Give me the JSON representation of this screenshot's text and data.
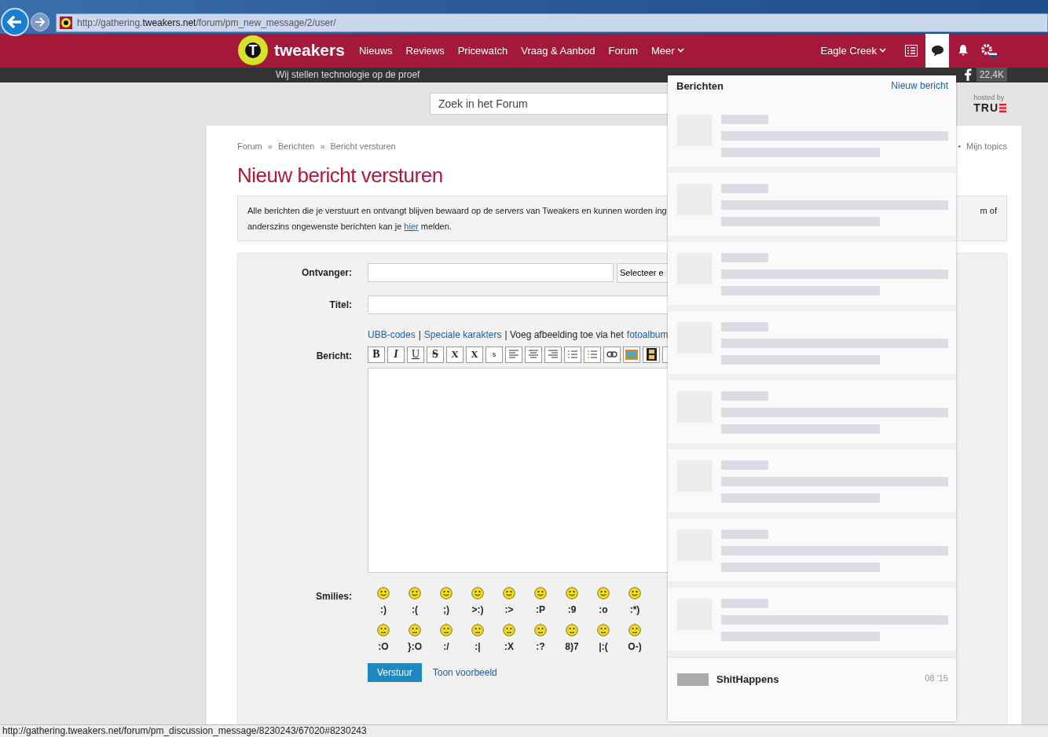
{
  "browser": {
    "url_before": "http://gathering.",
    "url_domain": "tweakers.net",
    "url_after": "/forum/pm_new_message/2/user/"
  },
  "nav": {
    "logo_mark": "T",
    "logo_text": "tweakers",
    "items": [
      {
        "label": "Nieuws",
        "caret": false
      },
      {
        "label": "Reviews",
        "caret": false
      },
      {
        "label": "Pricewatch",
        "caret": false
      },
      {
        "label": "Vraag & Aanbod",
        "caret": false
      },
      {
        "label": "Forum",
        "caret": false
      },
      {
        "label": "Meer",
        "caret": true
      }
    ],
    "user": "Eagle Creek",
    "icons": [
      {
        "kind": "list",
        "selected": false
      },
      {
        "kind": "chat",
        "selected": true
      },
      {
        "kind": "bell",
        "selected": false
      },
      {
        "kind": "settings",
        "selected": false
      }
    ]
  },
  "subbar": {
    "tagline": "Wij stellen technologie op de proef",
    "likes": "22,4K"
  },
  "search": {
    "placeholder": "Zoek in het Forum"
  },
  "hosting": {
    "label": "hosted by",
    "logo": "TRU"
  },
  "breadcrumb": {
    "separator": "»",
    "items": [
      "Forum",
      "Berichten",
      "Bericht versturen"
    ],
    "right_separator": "•",
    "right_link": "Mijn topics"
  },
  "title": "Nieuw bericht versturen",
  "notice": {
    "line_1": "Alle berichten die je verstuurt en ontvangt blijven bewaard op de servers van Tweakers en kunnen worden ing",
    "line_1_end": "m of",
    "line_2_before": "anderszins ongewenste berichten kan je",
    "link": "hier",
    "line_2_after": "melden."
  },
  "form": {
    "recipient_label": "Ontvanger:",
    "select_button": "Selecteer e",
    "title_label": "Titel:",
    "links": [
      {
        "label": "UBB-codes",
        "kind": "link"
      },
      {
        "label": "|",
        "kind": "text"
      },
      {
        "label": "Speciale karakters",
        "kind": "link"
      },
      {
        "label": "| Voeg afbeelding toe via het",
        "kind": "text"
      },
      {
        "label": "fotoalbum",
        "kind": "link"
      }
    ],
    "message_label": "Bericht:",
    "smilies_label": "Smilies:",
    "submit": "Verstuur",
    "preview": "Toon voorbeeld"
  },
  "toolbar": [
    {
      "kind": "text",
      "label": "B"
    },
    {
      "kind": "text",
      "label": "I"
    },
    {
      "kind": "text",
      "label": "U"
    },
    {
      "kind": "text",
      "label": "S"
    },
    {
      "kind": "text",
      "label": "X"
    },
    {
      "kind": "text",
      "label": "X"
    },
    {
      "kind": "text",
      "label": "s"
    },
    {
      "kind": "align_left"
    },
    {
      "kind": "align_center"
    },
    {
      "kind": "align_right"
    },
    {
      "kind": "bullets"
    },
    {
      "kind": "numbers"
    },
    {
      "kind": "link"
    },
    {
      "kind": "image"
    },
    {
      "kind": "video"
    },
    {
      "kind": "partial"
    }
  ],
  "smilies": [
    [
      ":)",
      ":(",
      ";)",
      ">:)",
      ":>",
      ":P",
      ":9",
      ":o",
      ":*)"
    ],
    [
      ":O",
      "}:O",
      ":/",
      ":|",
      ":X",
      ":?",
      "8)7",
      "|:(",
      "O-)"
    ]
  ],
  "messages_panel": {
    "title": "Berichten",
    "new_link": "Nieuw bericht",
    "messages": [
      {
        "kind": "blurred"
      },
      {
        "kind": "blurred"
      },
      {
        "kind": "blurred"
      },
      {
        "kind": "blurred"
      },
      {
        "kind": "blurred"
      },
      {
        "kind": "blurred"
      },
      {
        "kind": "blurred"
      },
      {
        "kind": "blurred"
      },
      {
        "kind": "visible",
        "sender": "ShitHappens",
        "date": "08 '15"
      }
    ]
  },
  "status_bar": "http://gathering.tweakers.net/forum/pm_discussion_message/8230243/67020#8230243"
}
